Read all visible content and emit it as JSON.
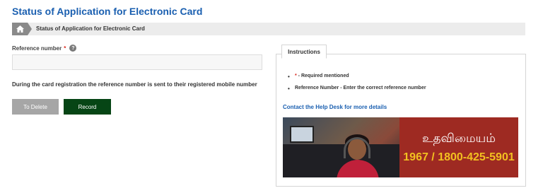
{
  "page": {
    "title": "Status of Application for Electronic Card"
  },
  "breadcrumb": {
    "home_icon": "home-icon",
    "current": "Status of Application for Electronic Card"
  },
  "form": {
    "reference_label": "Reference number",
    "required_mark": "*",
    "help_icon": "question-circle-icon",
    "reference_value": "",
    "reference_placeholder": "",
    "note": "During the card registration the reference number is sent to their registered mobile number",
    "delete_label": "To Delete",
    "record_label": "Record"
  },
  "instructions": {
    "tab_label": "Instructions",
    "items": [
      {
        "mark": "*",
        "text": " - Required mentioned"
      },
      {
        "mark": "",
        "text": "Reference Number - Enter the correct reference number"
      }
    ],
    "help_link": "Contact the Help Desk for more details"
  },
  "banner": {
    "title": "உதவிமையம்",
    "phone": "1967 / 1800-425-5901"
  },
  "colors": {
    "title_blue": "#1a5fb0",
    "record_green": "#064515",
    "delete_gray": "#a6a6a6",
    "banner_red": "#9e2a22",
    "phone_yellow": "#f2c020"
  }
}
